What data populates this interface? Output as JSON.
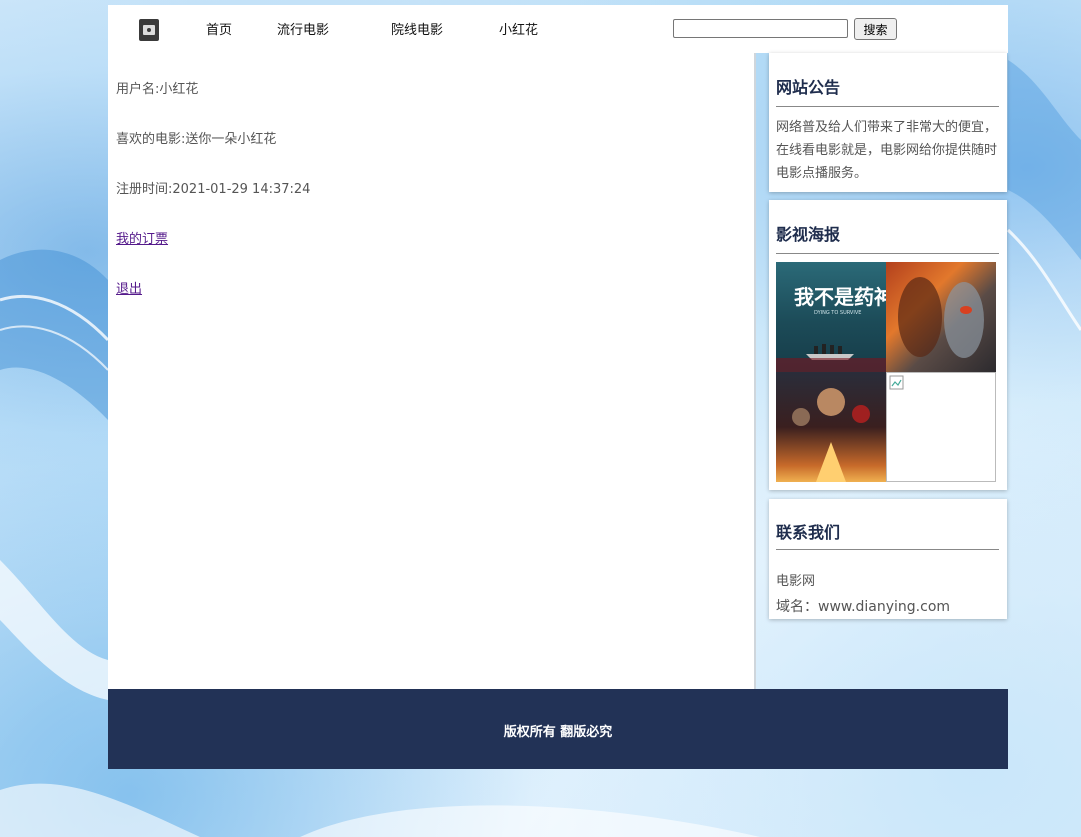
{
  "nav": {
    "items": [
      {
        "label": "首页"
      },
      {
        "label": "流行电影"
      },
      {
        "label": "院线电影"
      },
      {
        "label": "小红花"
      }
    ],
    "search": {
      "value": "",
      "button_label": "搜索"
    }
  },
  "profile": {
    "username": "用户名:小红花",
    "favorite": "喜欢的电影:送你一朵小红花",
    "registered": "注册时间:2021-01-29 14:37:24",
    "tickets_link": "我的订票",
    "logout_link": "退出"
  },
  "sidebar": {
    "notice": {
      "title": "网站公告",
      "body": "网络普及给人们带来了非常大的便宜，在线看电影就是，电影网给你提供随时电影点播服务。"
    },
    "posters": {
      "title": "影视海报",
      "poster1_text": "我不是药神",
      "poster1_subtext": "DYING TO SURVIVE"
    },
    "contact": {
      "title": "联系我们",
      "line1": "电影网",
      "line2": "域名：www.dianying.com"
    }
  },
  "footer": {
    "text": "版权所有 翻版必究"
  },
  "colors": {
    "footer_bg": "#223256",
    "heading": "#1f2d4d",
    "visited_link": "#551a8b"
  }
}
